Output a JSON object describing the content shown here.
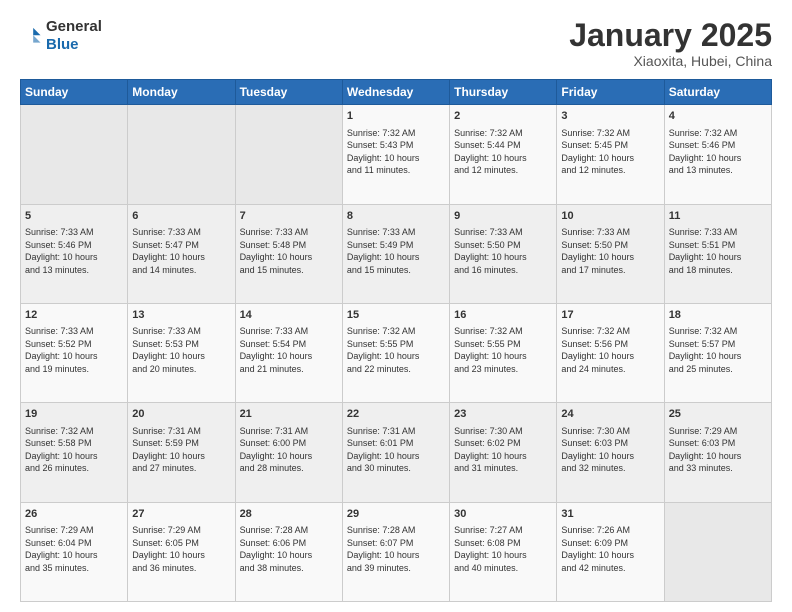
{
  "header": {
    "logo_general": "General",
    "logo_blue": "Blue",
    "title": "January 2025",
    "subtitle": "Xiaoxita, Hubei, China"
  },
  "weekdays": [
    "Sunday",
    "Monday",
    "Tuesday",
    "Wednesday",
    "Thursday",
    "Friday",
    "Saturday"
  ],
  "weeks": [
    [
      {
        "day": "",
        "content": ""
      },
      {
        "day": "",
        "content": ""
      },
      {
        "day": "",
        "content": ""
      },
      {
        "day": "1",
        "content": "Sunrise: 7:32 AM\nSunset: 5:43 PM\nDaylight: 10 hours\nand 11 minutes."
      },
      {
        "day": "2",
        "content": "Sunrise: 7:32 AM\nSunset: 5:44 PM\nDaylight: 10 hours\nand 12 minutes."
      },
      {
        "day": "3",
        "content": "Sunrise: 7:32 AM\nSunset: 5:45 PM\nDaylight: 10 hours\nand 12 minutes."
      },
      {
        "day": "4",
        "content": "Sunrise: 7:32 AM\nSunset: 5:46 PM\nDaylight: 10 hours\nand 13 minutes."
      }
    ],
    [
      {
        "day": "5",
        "content": "Sunrise: 7:33 AM\nSunset: 5:46 PM\nDaylight: 10 hours\nand 13 minutes."
      },
      {
        "day": "6",
        "content": "Sunrise: 7:33 AM\nSunset: 5:47 PM\nDaylight: 10 hours\nand 14 minutes."
      },
      {
        "day": "7",
        "content": "Sunrise: 7:33 AM\nSunset: 5:48 PM\nDaylight: 10 hours\nand 15 minutes."
      },
      {
        "day": "8",
        "content": "Sunrise: 7:33 AM\nSunset: 5:49 PM\nDaylight: 10 hours\nand 15 minutes."
      },
      {
        "day": "9",
        "content": "Sunrise: 7:33 AM\nSunset: 5:50 PM\nDaylight: 10 hours\nand 16 minutes."
      },
      {
        "day": "10",
        "content": "Sunrise: 7:33 AM\nSunset: 5:50 PM\nDaylight: 10 hours\nand 17 minutes."
      },
      {
        "day": "11",
        "content": "Sunrise: 7:33 AM\nSunset: 5:51 PM\nDaylight: 10 hours\nand 18 minutes."
      }
    ],
    [
      {
        "day": "12",
        "content": "Sunrise: 7:33 AM\nSunset: 5:52 PM\nDaylight: 10 hours\nand 19 minutes."
      },
      {
        "day": "13",
        "content": "Sunrise: 7:33 AM\nSunset: 5:53 PM\nDaylight: 10 hours\nand 20 minutes."
      },
      {
        "day": "14",
        "content": "Sunrise: 7:33 AM\nSunset: 5:54 PM\nDaylight: 10 hours\nand 21 minutes."
      },
      {
        "day": "15",
        "content": "Sunrise: 7:32 AM\nSunset: 5:55 PM\nDaylight: 10 hours\nand 22 minutes."
      },
      {
        "day": "16",
        "content": "Sunrise: 7:32 AM\nSunset: 5:55 PM\nDaylight: 10 hours\nand 23 minutes."
      },
      {
        "day": "17",
        "content": "Sunrise: 7:32 AM\nSunset: 5:56 PM\nDaylight: 10 hours\nand 24 minutes."
      },
      {
        "day": "18",
        "content": "Sunrise: 7:32 AM\nSunset: 5:57 PM\nDaylight: 10 hours\nand 25 minutes."
      }
    ],
    [
      {
        "day": "19",
        "content": "Sunrise: 7:32 AM\nSunset: 5:58 PM\nDaylight: 10 hours\nand 26 minutes."
      },
      {
        "day": "20",
        "content": "Sunrise: 7:31 AM\nSunset: 5:59 PM\nDaylight: 10 hours\nand 27 minutes."
      },
      {
        "day": "21",
        "content": "Sunrise: 7:31 AM\nSunset: 6:00 PM\nDaylight: 10 hours\nand 28 minutes."
      },
      {
        "day": "22",
        "content": "Sunrise: 7:31 AM\nSunset: 6:01 PM\nDaylight: 10 hours\nand 30 minutes."
      },
      {
        "day": "23",
        "content": "Sunrise: 7:30 AM\nSunset: 6:02 PM\nDaylight: 10 hours\nand 31 minutes."
      },
      {
        "day": "24",
        "content": "Sunrise: 7:30 AM\nSunset: 6:03 PM\nDaylight: 10 hours\nand 32 minutes."
      },
      {
        "day": "25",
        "content": "Sunrise: 7:29 AM\nSunset: 6:03 PM\nDaylight: 10 hours\nand 33 minutes."
      }
    ],
    [
      {
        "day": "26",
        "content": "Sunrise: 7:29 AM\nSunset: 6:04 PM\nDaylight: 10 hours\nand 35 minutes."
      },
      {
        "day": "27",
        "content": "Sunrise: 7:29 AM\nSunset: 6:05 PM\nDaylight: 10 hours\nand 36 minutes."
      },
      {
        "day": "28",
        "content": "Sunrise: 7:28 AM\nSunset: 6:06 PM\nDaylight: 10 hours\nand 38 minutes."
      },
      {
        "day": "29",
        "content": "Sunrise: 7:28 AM\nSunset: 6:07 PM\nDaylight: 10 hours\nand 39 minutes."
      },
      {
        "day": "30",
        "content": "Sunrise: 7:27 AM\nSunset: 6:08 PM\nDaylight: 10 hours\nand 40 minutes."
      },
      {
        "day": "31",
        "content": "Sunrise: 7:26 AM\nSunset: 6:09 PM\nDaylight: 10 hours\nand 42 minutes."
      },
      {
        "day": "",
        "content": ""
      }
    ]
  ]
}
